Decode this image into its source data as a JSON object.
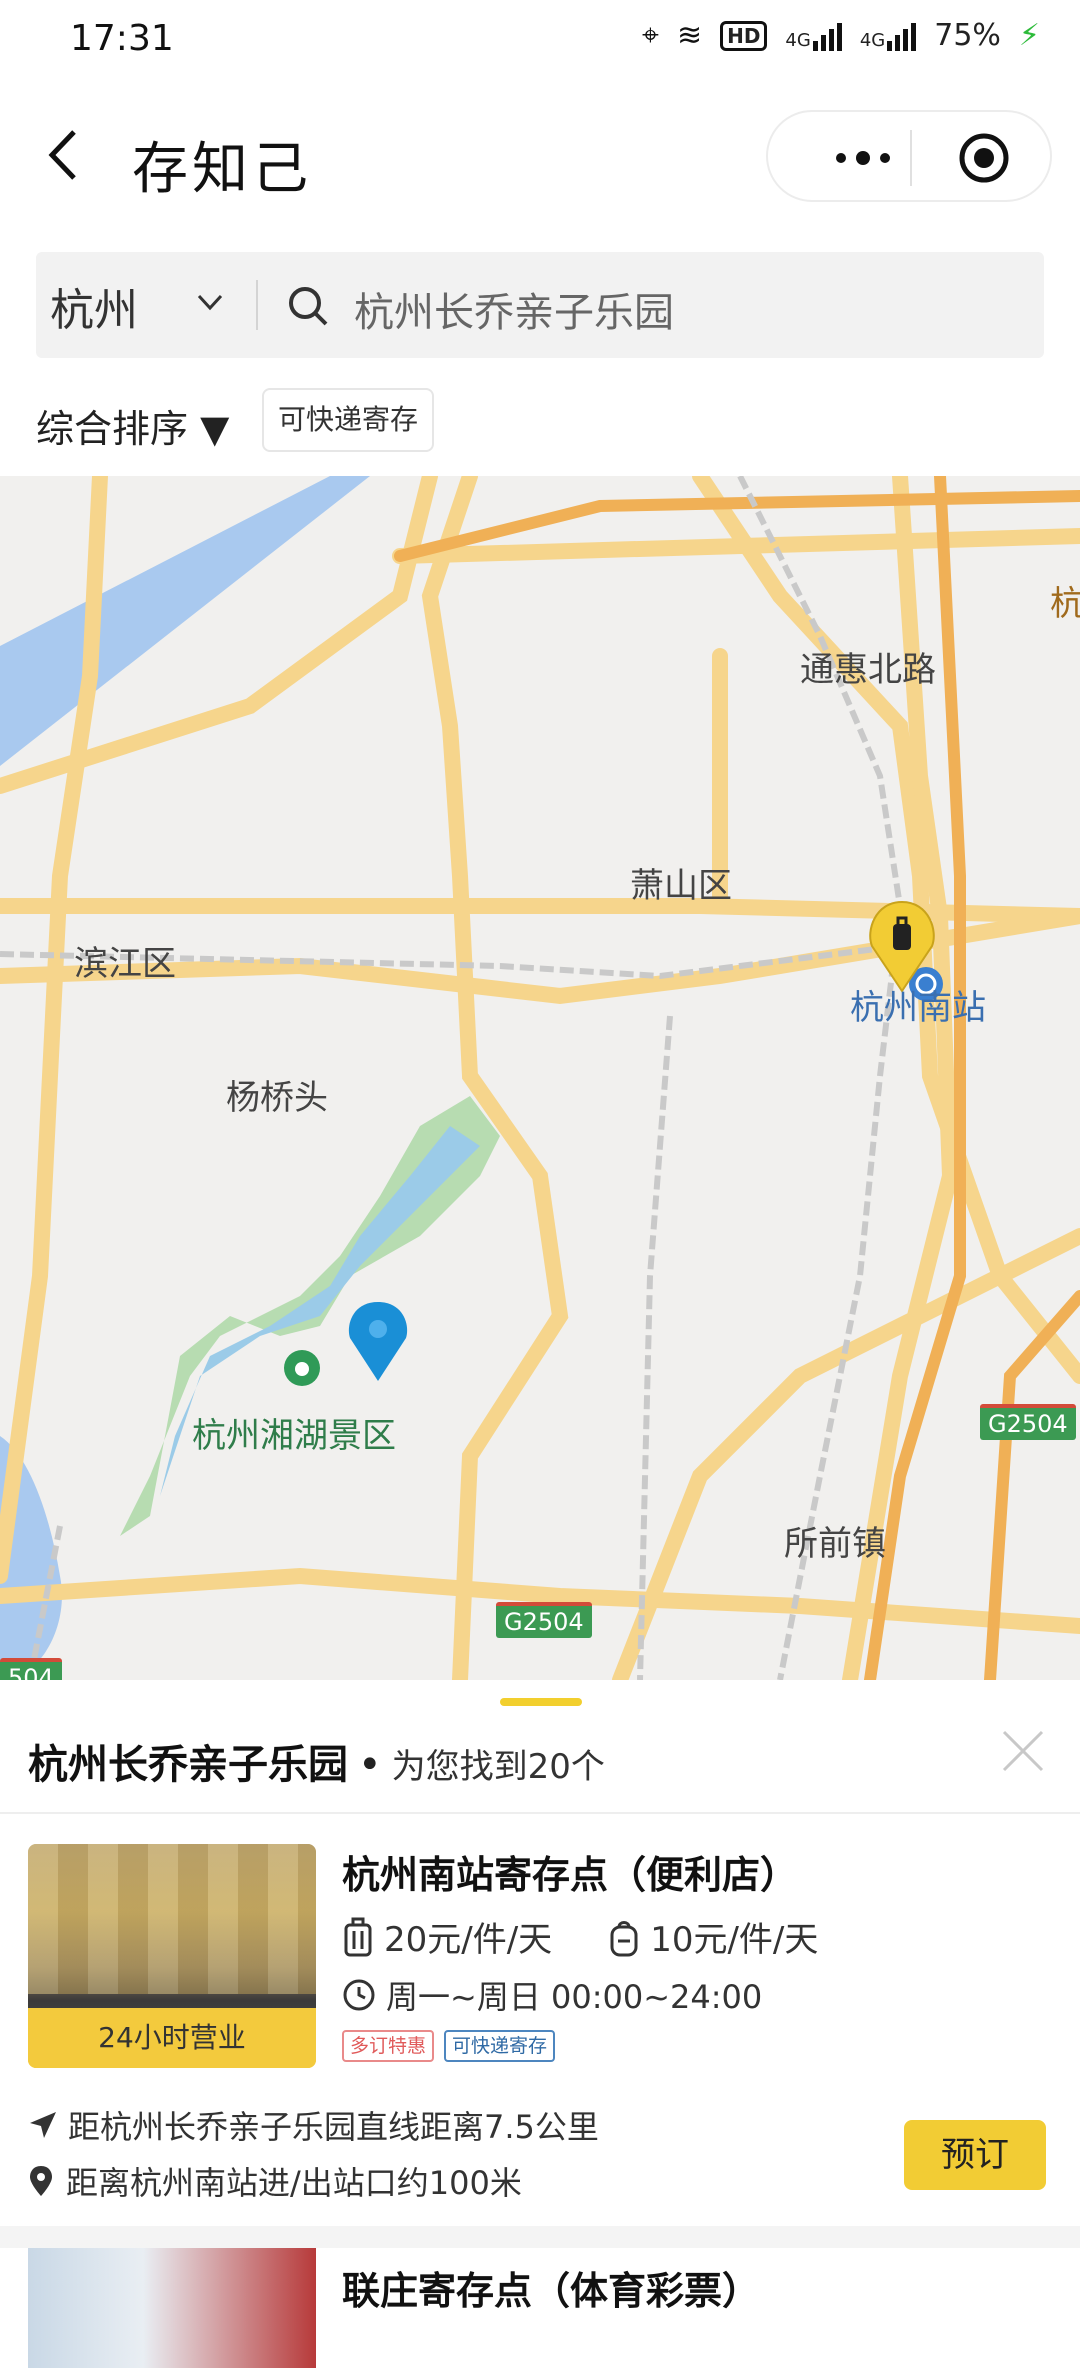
{
  "status_bar": {
    "time": "17:31",
    "battery": "75%",
    "signal1": "4G",
    "signal2": "4G",
    "hd": "HD"
  },
  "header": {
    "title": "存知己"
  },
  "search": {
    "city": "杭州",
    "query": "杭州长乔亲子乐园"
  },
  "filters": {
    "sort_label": "综合排序 ▼",
    "chip_label": "可快递寄存"
  },
  "map": {
    "labels": {
      "tonghui": "通惠北路",
      "xiaoshan": "萧山区",
      "binjiang": "滨江区",
      "south_station": "杭州南站",
      "yangqiaotou": "杨桥头",
      "xianghu": "杭州湘湖景区",
      "suoqian": "所前镇",
      "edge": "杭"
    },
    "highways": {
      "h1": "G2504",
      "h2": "G2504",
      "h3": "504"
    }
  },
  "sheet": {
    "title": "杭州长乔亲子乐园",
    "found": "为您找到20个",
    "dot": "•"
  },
  "card1": {
    "name": "杭州南站寄存点（便利店）",
    "price_luggage": "20元/件/天",
    "price_bag": "10元/件/天",
    "hours": "周一~周日 00:00~24:00",
    "badge": "24小时营业",
    "tag1": "多订特惠",
    "tag2": "可快递寄存",
    "distance": "距杭州长乔亲子乐园直线距离7.5公里",
    "location_note": "距离杭州南站进/出站口约100米",
    "book": "预订"
  },
  "card2": {
    "name": "联庄寄存点（体育彩票）"
  },
  "colors": {
    "accent": "#f2cc34",
    "pin_blue": "#1a8fd6",
    "road": "#f7d98a"
  }
}
